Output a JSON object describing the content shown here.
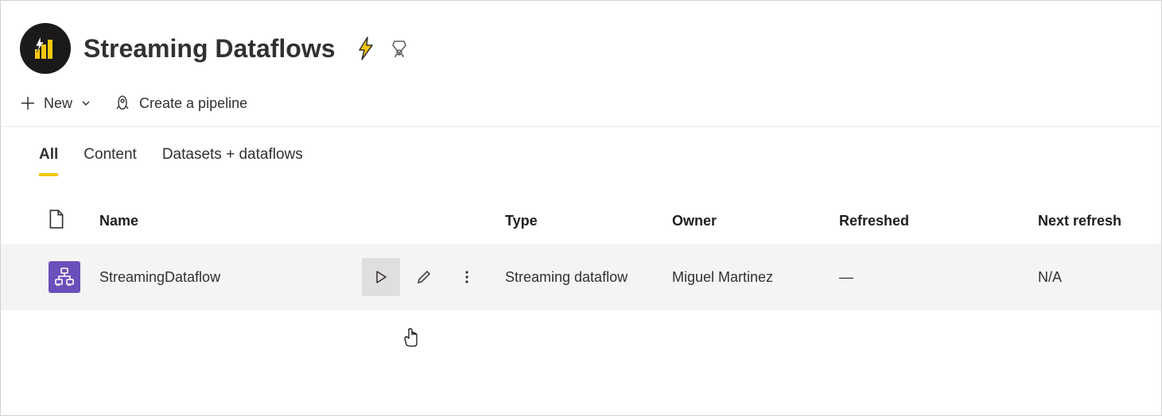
{
  "workspace": {
    "title": "Streaming Dataflows"
  },
  "toolbar": {
    "new_label": "New",
    "pipeline_label": "Create a pipeline"
  },
  "tabs": [
    {
      "label": "All",
      "active": true
    },
    {
      "label": "Content",
      "active": false
    },
    {
      "label": "Datasets + dataflows",
      "active": false
    }
  ],
  "columns": {
    "name": "Name",
    "type": "Type",
    "owner": "Owner",
    "refreshed": "Refreshed",
    "next_refresh": "Next refresh"
  },
  "rows": [
    {
      "name": "StreamingDataflow",
      "type": "Streaming dataflow",
      "owner": "Miguel Martinez",
      "refreshed": "—",
      "next_refresh": "N/A"
    }
  ]
}
